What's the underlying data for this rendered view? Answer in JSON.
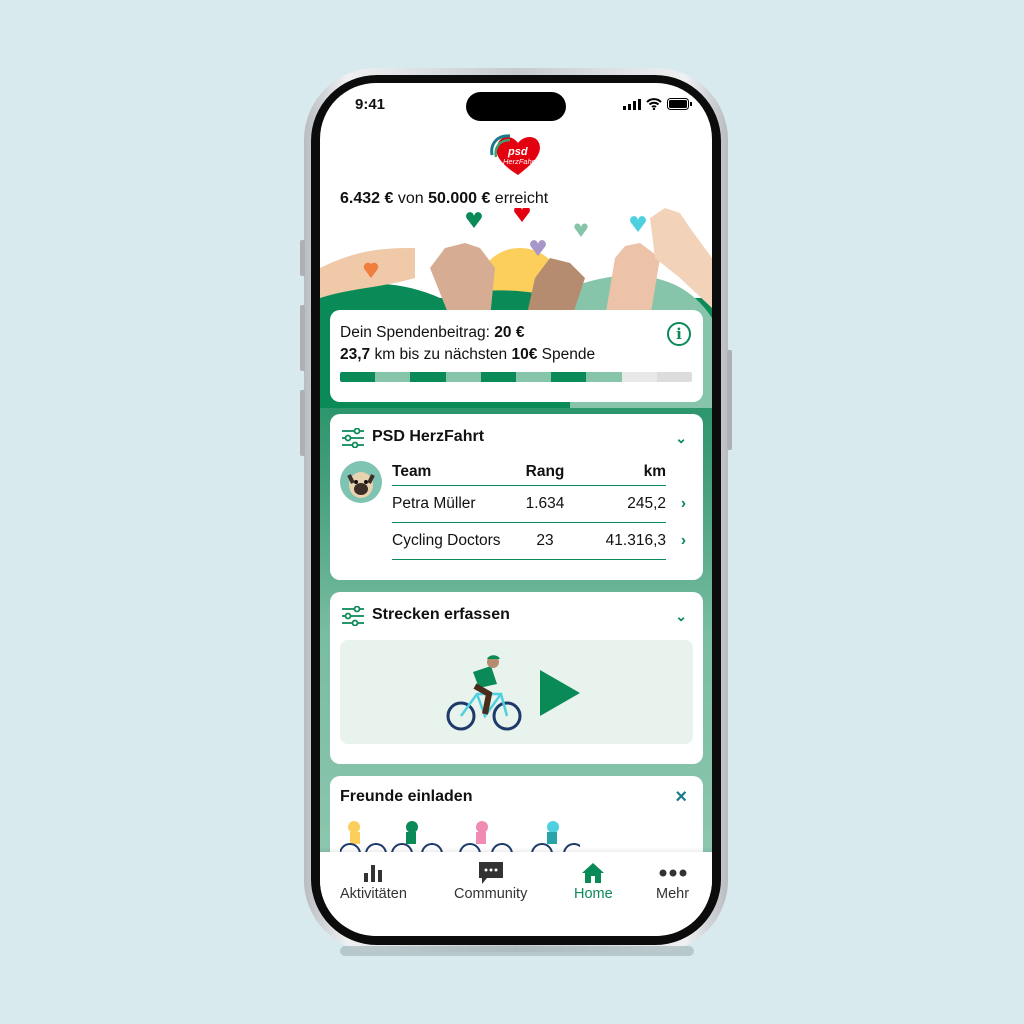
{
  "status": {
    "time": "9:41"
  },
  "logo": {
    "text": "psd HerzFahrt"
  },
  "goal": {
    "current": "6.432 €",
    "mid": " von ",
    "target": "50.000 €",
    "suffix": " erreicht"
  },
  "donation": {
    "label": "Dein Spendenbeitrag: ",
    "amount": "20 €",
    "km": "23,7",
    "km_text": " km bis zu nächsten ",
    "next": "10€",
    "next_suffix": " Spende",
    "progress_segments_filled": 8,
    "progress_segments_total": 10
  },
  "event": {
    "title": "PSD HerzFahrt",
    "headers": [
      "Team",
      "Rang",
      "km"
    ],
    "rows": [
      {
        "name": "Petra Müller",
        "rank": "1.634",
        "km": "245,2"
      },
      {
        "name": "Cycling Doctors",
        "rank": "23",
        "km": "41.316,3"
      }
    ]
  },
  "track": {
    "title": "Strecken erfassen"
  },
  "invite": {
    "title": "Freunde einladen"
  },
  "nav": [
    {
      "label": "Aktivitäten",
      "icon": "bar-chart-icon"
    },
    {
      "label": "Community",
      "icon": "chat-icon"
    },
    {
      "label": "Home",
      "icon": "home-icon",
      "active": true
    },
    {
      "label": "Mehr",
      "icon": "more-icon"
    }
  ],
  "colors": {
    "primary": "#0a8a57",
    "light": "#86c5aa",
    "heart": "#e3000f",
    "background": "#d8eaee"
  }
}
